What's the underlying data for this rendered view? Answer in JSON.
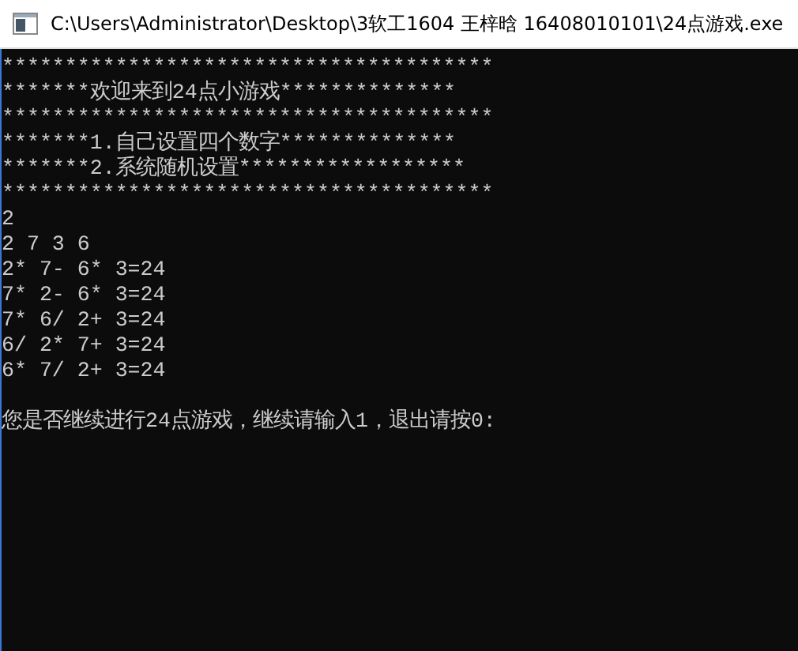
{
  "window": {
    "title": "C:\\Users\\Administrator\\Desktop\\3软工1604 王梓晗 16408010101\\24点游戏.exe"
  },
  "console": {
    "lines": [
      "***************************************",
      "*******欢迎来到24点小游戏**************",
      "***************************************",
      "*******1.自己设置四个数字**************",
      "*******2.系统随机设置******************",
      "***************************************",
      "2",
      "2 7 3 6",
      "2* 7- 6* 3=24",
      "7* 2- 6* 3=24",
      "7* 6/ 2+ 3=24",
      "6/ 2* 7+ 3=24",
      "6* 7/ 2+ 3=24"
    ],
    "prompt": "您是否继续进行24点游戏，继续请输入1，退出请按0:"
  }
}
